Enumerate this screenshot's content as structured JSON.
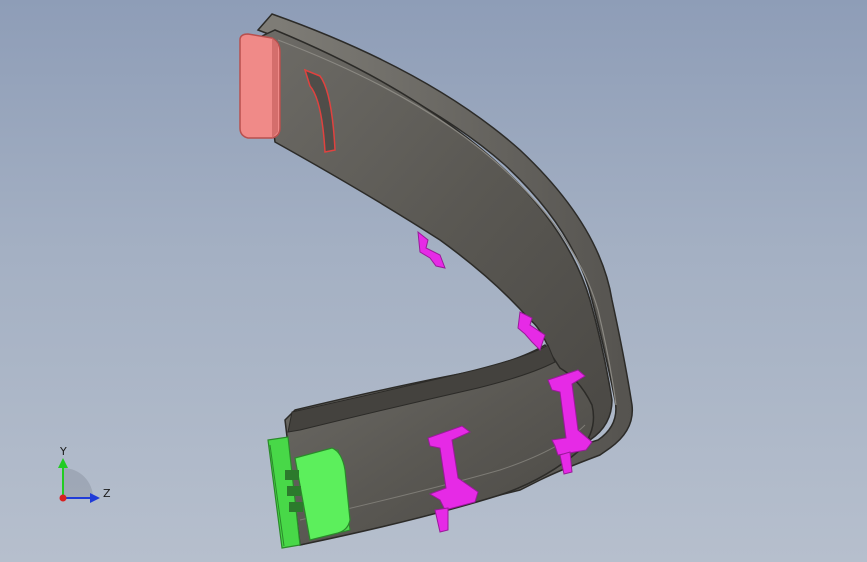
{
  "viewport": {
    "background_top": "#8e9db7",
    "background_bottom": "#b6bfcd"
  },
  "model": {
    "chain_body_color": "#5f5d58",
    "chain_edge_color": "#2f2e2b",
    "end_cap_red_color": "#f28a88",
    "end_bracket_green_color": "#56ef56",
    "separator_color": "#e62ae6"
  },
  "triad": {
    "y_label": "Y",
    "z_label": "Z",
    "y_color": "#22cc22",
    "z_color": "#1f3bd8",
    "x_color": "#d81f1f"
  }
}
